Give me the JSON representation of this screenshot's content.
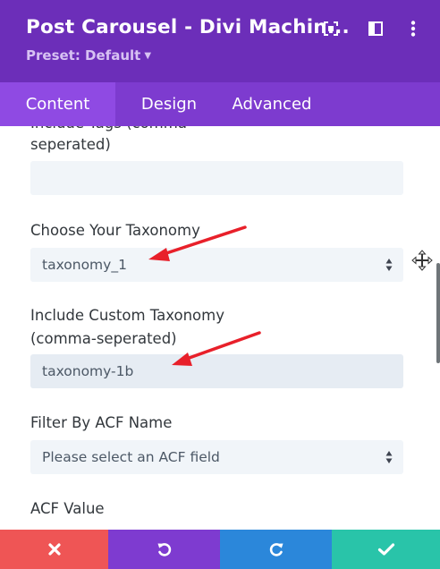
{
  "header": {
    "title": "Post Carousel - Divi Machin...",
    "preset": "Preset: Default",
    "icons": [
      "fullscreen-icon",
      "split-view-icon",
      "more-vertical-icon"
    ],
    "color": "#6c2eb9"
  },
  "tabs": [
    {
      "label": "Content",
      "active": true
    },
    {
      "label": "Design",
      "active": false
    },
    {
      "label": "Advanced",
      "active": false
    }
  ],
  "form": {
    "include_tags_label_line1": "Include Tags (comma-",
    "include_tags_label_line2": "seperated)",
    "include_tags_value": "",
    "taxonomy_label": "Choose Your Taxonomy",
    "taxonomy_value": "taxonomy_1",
    "custom_taxonomy_label_line1": "Include Custom Taxonomy",
    "custom_taxonomy_label_line2": "(comma-seperated)",
    "custom_taxonomy_value": "taxonomy-1b",
    "acf_name_label": "Filter By ACF Name",
    "acf_name_value": "Please select an ACF field",
    "acf_value_label": "ACF Value"
  },
  "annotations": {
    "arrow_color": "#e8202a"
  },
  "footer": {
    "buttons": [
      {
        "name": "discard",
        "icon": "close-icon",
        "color": "#ef5555"
      },
      {
        "name": "undo",
        "icon": "undo-icon",
        "color": "#7e3bd0"
      },
      {
        "name": "redo",
        "icon": "redo-icon",
        "color": "#2b87da"
      },
      {
        "name": "save",
        "icon": "check-icon",
        "color": "#29c4a9"
      }
    ]
  }
}
